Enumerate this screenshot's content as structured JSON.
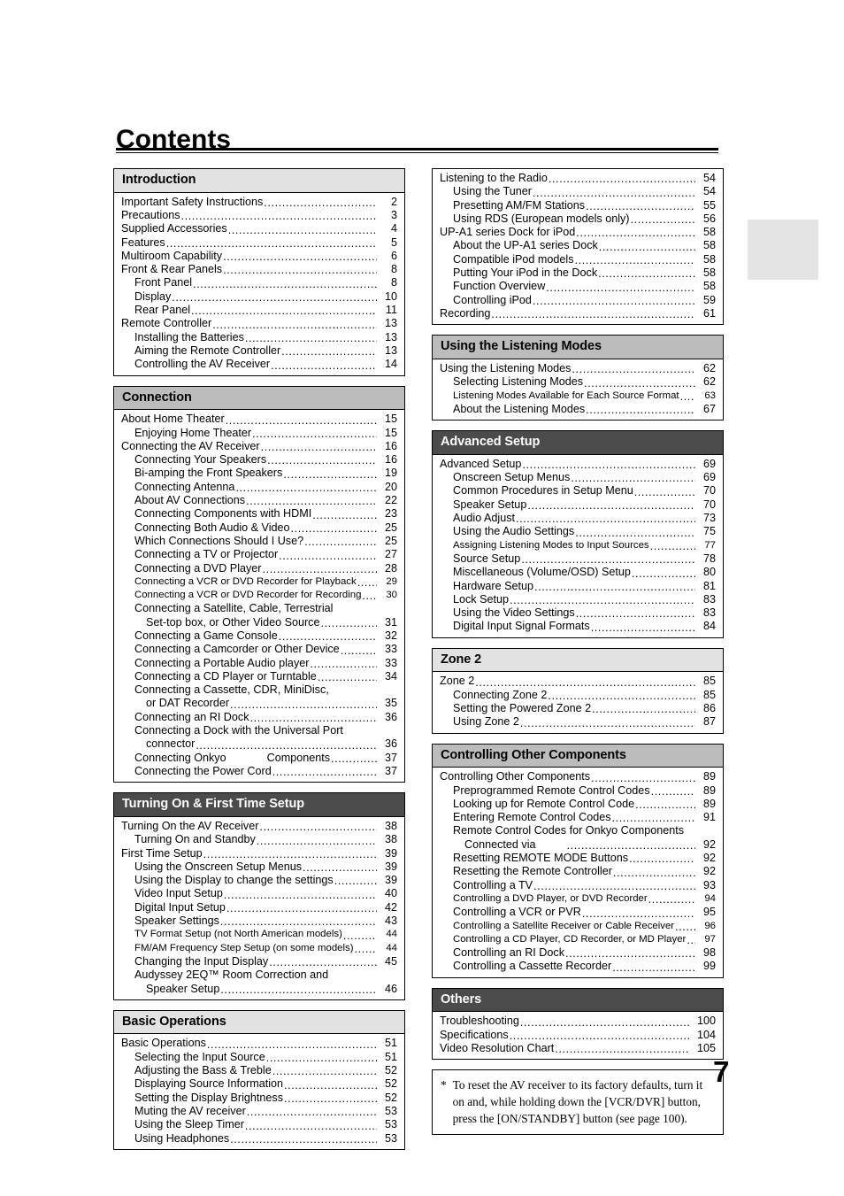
{
  "page": {
    "title": "Contents",
    "folio": "7"
  },
  "footnote": {
    "marker": "*",
    "text": "To reset the AV receiver to its factory defaults, turn it on and, while holding down the [VCR/DVR] button, press the [ON/STANDBY] button (see page 100)."
  },
  "left_column": [
    {
      "heading": "Introduction",
      "style": "light",
      "entries": [
        {
          "label": "Important Safety Instructions",
          "page": "2",
          "level": 1
        },
        {
          "label": "Precautions",
          "page": "3",
          "level": 1
        },
        {
          "label": "Supplied Accessories",
          "page": "4",
          "level": 1
        },
        {
          "label": "Features",
          "page": "5",
          "level": 1
        },
        {
          "label": "Multiroom Capability",
          "page": "6",
          "level": 1
        },
        {
          "label": "Front & Rear Panels",
          "page": "8",
          "level": 1
        },
        {
          "label": "Front Panel",
          "page": "8",
          "level": 2
        },
        {
          "label": "Display",
          "page": "10",
          "level": 2
        },
        {
          "label": "Rear Panel",
          "page": "11",
          "level": 2
        },
        {
          "label": "Remote Controller",
          "page": "13",
          "level": 1
        },
        {
          "label": "Installing the Batteries",
          "page": "13",
          "level": 2
        },
        {
          "label": "Aiming the Remote Controller",
          "page": "13",
          "level": 2
        },
        {
          "label": "Controlling the AV Receiver",
          "page": "14",
          "level": 2
        }
      ]
    },
    {
      "heading": "Connection",
      "style": "mid",
      "entries": [
        {
          "label": "About Home Theater",
          "page": "15",
          "level": 1
        },
        {
          "label": "Enjoying Home Theater",
          "page": "15",
          "level": 2
        },
        {
          "label": "Connecting the AV Receiver",
          "page": "16",
          "level": 1
        },
        {
          "label": "Connecting Your Speakers",
          "page": "16",
          "level": 2
        },
        {
          "label": "Bi-amping the Front Speakers",
          "page": "19",
          "level": 2
        },
        {
          "label": "Connecting Antenna",
          "page": "20",
          "level": 2
        },
        {
          "label": "About AV Connections",
          "page": "22",
          "level": 2
        },
        {
          "label": "Connecting Components with HDMI",
          "page": "23",
          "level": 2
        },
        {
          "label": "Connecting Both Audio & Video",
          "page": "25",
          "level": 2
        },
        {
          "label": "Which Connections Should I Use?",
          "page": "25",
          "level": 2
        },
        {
          "label": "Connecting a TV or Projector",
          "page": "27",
          "level": 2
        },
        {
          "label": "Connecting a DVD Player",
          "page": "28",
          "level": 2
        },
        {
          "label": "Connecting a VCR or DVD Recorder for Playback",
          "page": "29",
          "level": 2,
          "small": true
        },
        {
          "label": "Connecting a VCR or DVD Recorder for Recording",
          "page": "30",
          "level": 2,
          "small": true
        },
        {
          "label": "Connecting a Satellite, Cable, Terrestrial",
          "page": "",
          "level": 2,
          "wrap_start": true
        },
        {
          "label": "Set-top box, or Other Video Source",
          "page": "31",
          "level": 3
        },
        {
          "label": "Connecting a Game Console",
          "page": "32",
          "level": 2
        },
        {
          "label": "Connecting a Camcorder or Other Device",
          "page": "33",
          "level": 2
        },
        {
          "label": "Connecting a Portable Audio player",
          "page": "33",
          "level": 2
        },
        {
          "label": "Connecting a CD Player or Turntable",
          "page": "34",
          "level": 2
        },
        {
          "label": "Connecting a Cassette, CDR, MiniDisc,",
          "page": "",
          "level": 2,
          "wrap_start": true
        },
        {
          "label": "or DAT Recorder",
          "page": "35",
          "level": 3
        },
        {
          "label": "Connecting an RI Dock",
          "page": "36",
          "level": 2
        },
        {
          "label": "Connecting a Dock with the Universal Port",
          "page": "",
          "level": 2,
          "wrap_start": true
        },
        {
          "label": "connector",
          "page": "36",
          "level": 3
        },
        {
          "label": "Connecting Onkyo",
          "label_tail": "Components",
          "page": "37",
          "level": 2,
          "ri_gap": true
        },
        {
          "label": "Connecting the Power Cord",
          "page": "37",
          "level": 2
        }
      ]
    },
    {
      "heading": "Turning On & First Time Setup",
      "style": "dark",
      "entries": [
        {
          "label": "Turning On the AV Receiver",
          "page": "38",
          "level": 1
        },
        {
          "label": "Turning On and Standby",
          "page": "38",
          "level": 2
        },
        {
          "label": "First Time Setup",
          "page": "39",
          "level": 1
        },
        {
          "label": "Using the Onscreen Setup Menus",
          "page": "39",
          "level": 2
        },
        {
          "label": "Using the Display to change the settings",
          "page": "39",
          "level": 2
        },
        {
          "label": "Video Input Setup",
          "page": "40",
          "level": 2
        },
        {
          "label": "Digital Input Setup",
          "page": "42",
          "level": 2
        },
        {
          "label": "Speaker Settings",
          "page": "43",
          "level": 2
        },
        {
          "label": "TV Format Setup (not North American models)",
          "page": "44",
          "level": 2,
          "small": true
        },
        {
          "label": "FM/AM Frequency Step Setup (on some models)",
          "page": "44",
          "level": 2,
          "small": true
        },
        {
          "label": "Changing the Input Display",
          "page": "45",
          "level": 2
        },
        {
          "label": "Audyssey 2EQ™ Room Correction and",
          "page": "",
          "level": 2,
          "wrap_start": true
        },
        {
          "label": "Speaker Setup",
          "page": "46",
          "level": 3
        }
      ]
    },
    {
      "heading": "Basic Operations",
      "style": "light",
      "entries": [
        {
          "label": "Basic Operations",
          "page": "51",
          "level": 1
        },
        {
          "label": "Selecting the Input Source",
          "page": "51",
          "level": 2
        },
        {
          "label": "Adjusting the Bass & Treble",
          "page": "52",
          "level": 2
        },
        {
          "label": "Displaying Source Information",
          "page": "52",
          "level": 2
        },
        {
          "label": "Setting the Display Brightness",
          "page": "52",
          "level": 2
        },
        {
          "label": "Muting the AV receiver",
          "page": "53",
          "level": 2
        },
        {
          "label": "Using the Sleep Timer",
          "page": "53",
          "level": 2
        },
        {
          "label": "Using Headphones",
          "page": "53",
          "level": 2
        }
      ]
    }
  ],
  "right_column": [
    {
      "heading": "",
      "style": "none",
      "entries": [
        {
          "label": "Listening to the Radio",
          "page": "54",
          "level": 1
        },
        {
          "label": "Using the Tuner",
          "page": "54",
          "level": 2
        },
        {
          "label": "Presetting AM/FM Stations",
          "page": "55",
          "level": 2
        },
        {
          "label": "Using RDS (European models only)",
          "page": "56",
          "level": 2
        },
        {
          "label": "UP-A1 series Dock for iPod",
          "page": "58",
          "level": 1
        },
        {
          "label": "About the UP-A1 series Dock",
          "page": "58",
          "level": 2
        },
        {
          "label": "Compatible iPod models",
          "page": "58",
          "level": 2
        },
        {
          "label": "Putting Your iPod in the Dock",
          "page": "58",
          "level": 2
        },
        {
          "label": "Function Overview",
          "page": "58",
          "level": 2
        },
        {
          "label": "Controlling iPod",
          "page": "59",
          "level": 2
        },
        {
          "label": "Recording",
          "page": "61",
          "level": 1
        }
      ]
    },
    {
      "heading": "Using the Listening Modes",
      "style": "mid",
      "entries": [
        {
          "label": "Using the Listening Modes",
          "page": "62",
          "level": 1
        },
        {
          "label": "Selecting Listening Modes",
          "page": "62",
          "level": 2
        },
        {
          "label": "Listening Modes Available for Each Source Format",
          "page": "63",
          "level": 2,
          "small": true
        },
        {
          "label": "About the Listening Modes",
          "page": "67",
          "level": 2
        }
      ]
    },
    {
      "heading": "Advanced Setup",
      "style": "dark",
      "entries": [
        {
          "label": "Advanced Setup",
          "page": "69",
          "level": 1
        },
        {
          "label": "Onscreen Setup Menus",
          "page": "69",
          "level": 2
        },
        {
          "label": "Common Procedures in Setup Menu",
          "page": "70",
          "level": 2
        },
        {
          "label": "Speaker Setup",
          "page": "70",
          "level": 2
        },
        {
          "label": "Audio Adjust",
          "page": "73",
          "level": 2
        },
        {
          "label": "Using the Audio Settings",
          "page": "75",
          "level": 2
        },
        {
          "label": "Assigning Listening Modes to Input Sources",
          "page": "77",
          "level": 2,
          "small": true
        },
        {
          "label": "Source Setup",
          "page": "78",
          "level": 2
        },
        {
          "label": "Miscellaneous (Volume/OSD) Setup",
          "page": "80",
          "level": 2
        },
        {
          "label": "Hardware Setup",
          "page": "81",
          "level": 2
        },
        {
          "label": "Lock Setup",
          "page": "83",
          "level": 2
        },
        {
          "label": "Using the Video Settings",
          "page": "83",
          "level": 2
        },
        {
          "label": "Digital Input Signal Formats",
          "page": "84",
          "level": 2
        }
      ]
    },
    {
      "heading": "Zone 2",
      "style": "light",
      "entries": [
        {
          "label": "Zone 2",
          "page": "85",
          "level": 1
        },
        {
          "label": "Connecting Zone 2",
          "page": "85",
          "level": 2
        },
        {
          "label": "Setting the Powered Zone 2",
          "page": "86",
          "level": 2
        },
        {
          "label": "Using Zone 2",
          "page": "87",
          "level": 2
        }
      ]
    },
    {
      "heading": "Controlling Other Components",
      "style": "mid",
      "entries": [
        {
          "label": "Controlling Other Components",
          "page": "89",
          "level": 1
        },
        {
          "label": "Preprogrammed Remote Control Codes",
          "page": "89",
          "level": 2
        },
        {
          "label": "Looking up for Remote Control Code",
          "page": "89",
          "level": 2
        },
        {
          "label": "Entering Remote Control Codes",
          "page": "91",
          "level": 2
        },
        {
          "label": "Remote Control Codes for Onkyo Components",
          "page": "",
          "level": 2,
          "wrap_start": true
        },
        {
          "label": "Connected via",
          "page": "92",
          "level": 3,
          "ri_gap_sm": true
        },
        {
          "label": "Resetting REMOTE MODE Buttons",
          "page": "92",
          "level": 2
        },
        {
          "label": "Resetting the Remote Controller",
          "page": "92",
          "level": 2
        },
        {
          "label": "Controlling a TV",
          "page": "93",
          "level": 2
        },
        {
          "label": "Controlling a DVD Player, or DVD Recorder",
          "page": "94",
          "level": 2,
          "small": true
        },
        {
          "label": "Controlling a VCR or PVR",
          "page": "95",
          "level": 2
        },
        {
          "label": "Controlling a Satellite Receiver or Cable Receiver",
          "page": "96",
          "level": 2,
          "small": true
        },
        {
          "label": "Controlling a CD Player, CD Recorder, or MD Player",
          "page": "97",
          "level": 2,
          "small": true
        },
        {
          "label": "Controlling an RI Dock",
          "page": "98",
          "level": 2
        },
        {
          "label": "Controlling a Cassette Recorder",
          "page": "99",
          "level": 2
        }
      ]
    },
    {
      "heading": "Others",
      "style": "dark",
      "entries": [
        {
          "label": "Troubleshooting",
          "page": "100",
          "level": 1,
          "wide": true
        },
        {
          "label": "Specifications",
          "page": "104",
          "level": 1,
          "wide": true
        },
        {
          "label": "Video Resolution Chart",
          "page": "105",
          "level": 1,
          "wide": true
        }
      ]
    }
  ]
}
